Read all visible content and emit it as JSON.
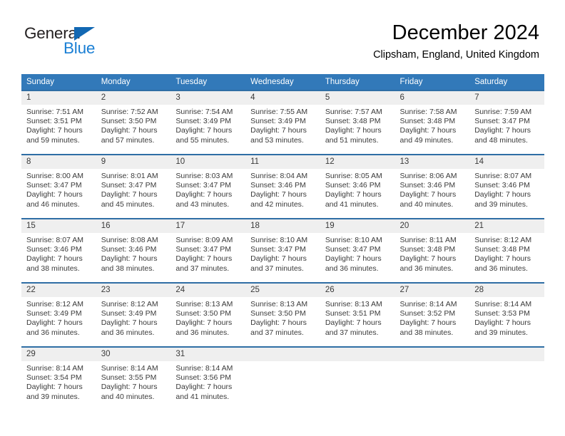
{
  "brand": {
    "name_part1": "General",
    "name_part2": "Blue",
    "triangle_icon": "triangle-icon",
    "color_dark": "#231f20",
    "color_blue": "#1a7fd4"
  },
  "header": {
    "month_title": "December 2024",
    "location": "Clipsham, England, United Kingdom"
  },
  "theme": {
    "header_row_bg": "#3279b9",
    "cell_top_border": "#2f6ea5",
    "daynum_band_bg": "#efefef",
    "text_color": "#3a3a3a"
  },
  "calendar": {
    "weekdays": [
      "Sunday",
      "Monday",
      "Tuesday",
      "Wednesday",
      "Thursday",
      "Friday",
      "Saturday"
    ],
    "weeks": [
      [
        {
          "day": "1",
          "sunrise": "Sunrise: 7:51 AM",
          "sunset": "Sunset: 3:51 PM",
          "daylight_line1": "Daylight: 7 hours",
          "daylight_line2": "and 59 minutes."
        },
        {
          "day": "2",
          "sunrise": "Sunrise: 7:52 AM",
          "sunset": "Sunset: 3:50 PM",
          "daylight_line1": "Daylight: 7 hours",
          "daylight_line2": "and 57 minutes."
        },
        {
          "day": "3",
          "sunrise": "Sunrise: 7:54 AM",
          "sunset": "Sunset: 3:49 PM",
          "daylight_line1": "Daylight: 7 hours",
          "daylight_line2": "and 55 minutes."
        },
        {
          "day": "4",
          "sunrise": "Sunrise: 7:55 AM",
          "sunset": "Sunset: 3:49 PM",
          "daylight_line1": "Daylight: 7 hours",
          "daylight_line2": "and 53 minutes."
        },
        {
          "day": "5",
          "sunrise": "Sunrise: 7:57 AM",
          "sunset": "Sunset: 3:48 PM",
          "daylight_line1": "Daylight: 7 hours",
          "daylight_line2": "and 51 minutes."
        },
        {
          "day": "6",
          "sunrise": "Sunrise: 7:58 AM",
          "sunset": "Sunset: 3:48 PM",
          "daylight_line1": "Daylight: 7 hours",
          "daylight_line2": "and 49 minutes."
        },
        {
          "day": "7",
          "sunrise": "Sunrise: 7:59 AM",
          "sunset": "Sunset: 3:47 PM",
          "daylight_line1": "Daylight: 7 hours",
          "daylight_line2": "and 48 minutes."
        }
      ],
      [
        {
          "day": "8",
          "sunrise": "Sunrise: 8:00 AM",
          "sunset": "Sunset: 3:47 PM",
          "daylight_line1": "Daylight: 7 hours",
          "daylight_line2": "and 46 minutes."
        },
        {
          "day": "9",
          "sunrise": "Sunrise: 8:01 AM",
          "sunset": "Sunset: 3:47 PM",
          "daylight_line1": "Daylight: 7 hours",
          "daylight_line2": "and 45 minutes."
        },
        {
          "day": "10",
          "sunrise": "Sunrise: 8:03 AM",
          "sunset": "Sunset: 3:47 PM",
          "daylight_line1": "Daylight: 7 hours",
          "daylight_line2": "and 43 minutes."
        },
        {
          "day": "11",
          "sunrise": "Sunrise: 8:04 AM",
          "sunset": "Sunset: 3:46 PM",
          "daylight_line1": "Daylight: 7 hours",
          "daylight_line2": "and 42 minutes."
        },
        {
          "day": "12",
          "sunrise": "Sunrise: 8:05 AM",
          "sunset": "Sunset: 3:46 PM",
          "daylight_line1": "Daylight: 7 hours",
          "daylight_line2": "and 41 minutes."
        },
        {
          "day": "13",
          "sunrise": "Sunrise: 8:06 AM",
          "sunset": "Sunset: 3:46 PM",
          "daylight_line1": "Daylight: 7 hours",
          "daylight_line2": "and 40 minutes."
        },
        {
          "day": "14",
          "sunrise": "Sunrise: 8:07 AM",
          "sunset": "Sunset: 3:46 PM",
          "daylight_line1": "Daylight: 7 hours",
          "daylight_line2": "and 39 minutes."
        }
      ],
      [
        {
          "day": "15",
          "sunrise": "Sunrise: 8:07 AM",
          "sunset": "Sunset: 3:46 PM",
          "daylight_line1": "Daylight: 7 hours",
          "daylight_line2": "and 38 minutes."
        },
        {
          "day": "16",
          "sunrise": "Sunrise: 8:08 AM",
          "sunset": "Sunset: 3:46 PM",
          "daylight_line1": "Daylight: 7 hours",
          "daylight_line2": "and 38 minutes."
        },
        {
          "day": "17",
          "sunrise": "Sunrise: 8:09 AM",
          "sunset": "Sunset: 3:47 PM",
          "daylight_line1": "Daylight: 7 hours",
          "daylight_line2": "and 37 minutes."
        },
        {
          "day": "18",
          "sunrise": "Sunrise: 8:10 AM",
          "sunset": "Sunset: 3:47 PM",
          "daylight_line1": "Daylight: 7 hours",
          "daylight_line2": "and 37 minutes."
        },
        {
          "day": "19",
          "sunrise": "Sunrise: 8:10 AM",
          "sunset": "Sunset: 3:47 PM",
          "daylight_line1": "Daylight: 7 hours",
          "daylight_line2": "and 36 minutes."
        },
        {
          "day": "20",
          "sunrise": "Sunrise: 8:11 AM",
          "sunset": "Sunset: 3:48 PM",
          "daylight_line1": "Daylight: 7 hours",
          "daylight_line2": "and 36 minutes."
        },
        {
          "day": "21",
          "sunrise": "Sunrise: 8:12 AM",
          "sunset": "Sunset: 3:48 PM",
          "daylight_line1": "Daylight: 7 hours",
          "daylight_line2": "and 36 minutes."
        }
      ],
      [
        {
          "day": "22",
          "sunrise": "Sunrise: 8:12 AM",
          "sunset": "Sunset: 3:49 PM",
          "daylight_line1": "Daylight: 7 hours",
          "daylight_line2": "and 36 minutes."
        },
        {
          "day": "23",
          "sunrise": "Sunrise: 8:12 AM",
          "sunset": "Sunset: 3:49 PM",
          "daylight_line1": "Daylight: 7 hours",
          "daylight_line2": "and 36 minutes."
        },
        {
          "day": "24",
          "sunrise": "Sunrise: 8:13 AM",
          "sunset": "Sunset: 3:50 PM",
          "daylight_line1": "Daylight: 7 hours",
          "daylight_line2": "and 36 minutes."
        },
        {
          "day": "25",
          "sunrise": "Sunrise: 8:13 AM",
          "sunset": "Sunset: 3:50 PM",
          "daylight_line1": "Daylight: 7 hours",
          "daylight_line2": "and 37 minutes."
        },
        {
          "day": "26",
          "sunrise": "Sunrise: 8:13 AM",
          "sunset": "Sunset: 3:51 PM",
          "daylight_line1": "Daylight: 7 hours",
          "daylight_line2": "and 37 minutes."
        },
        {
          "day": "27",
          "sunrise": "Sunrise: 8:14 AM",
          "sunset": "Sunset: 3:52 PM",
          "daylight_line1": "Daylight: 7 hours",
          "daylight_line2": "and 38 minutes."
        },
        {
          "day": "28",
          "sunrise": "Sunrise: 8:14 AM",
          "sunset": "Sunset: 3:53 PM",
          "daylight_line1": "Daylight: 7 hours",
          "daylight_line2": "and 39 minutes."
        }
      ],
      [
        {
          "day": "29",
          "sunrise": "Sunrise: 8:14 AM",
          "sunset": "Sunset: 3:54 PM",
          "daylight_line1": "Daylight: 7 hours",
          "daylight_line2": "and 39 minutes."
        },
        {
          "day": "30",
          "sunrise": "Sunrise: 8:14 AM",
          "sunset": "Sunset: 3:55 PM",
          "daylight_line1": "Daylight: 7 hours",
          "daylight_line2": "and 40 minutes."
        },
        {
          "day": "31",
          "sunrise": "Sunrise: 8:14 AM",
          "sunset": "Sunset: 3:56 PM",
          "daylight_line1": "Daylight: 7 hours",
          "daylight_line2": "and 41 minutes."
        },
        {
          "day": "",
          "sunrise": "",
          "sunset": "",
          "daylight_line1": "",
          "daylight_line2": ""
        },
        {
          "day": "",
          "sunrise": "",
          "sunset": "",
          "daylight_line1": "",
          "daylight_line2": ""
        },
        {
          "day": "",
          "sunrise": "",
          "sunset": "",
          "daylight_line1": "",
          "daylight_line2": ""
        },
        {
          "day": "",
          "sunrise": "",
          "sunset": "",
          "daylight_line1": "",
          "daylight_line2": ""
        }
      ]
    ]
  }
}
